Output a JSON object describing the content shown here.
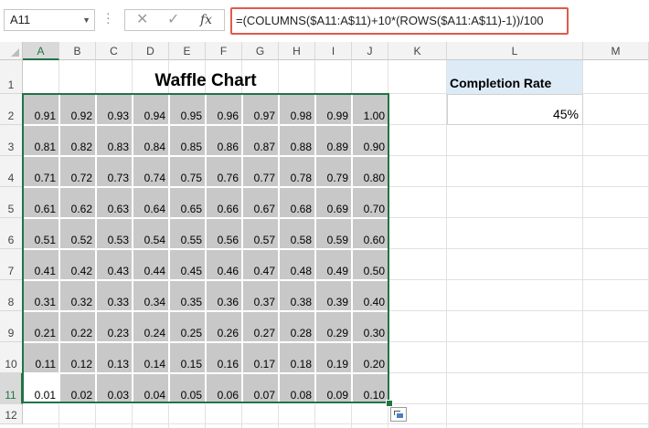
{
  "formula_bar": {
    "name_box": "A11",
    "cancel_glyph": "✕",
    "enter_glyph": "✓",
    "fx_label": "fx",
    "formula": "=(COLUMNS($A11:A$11)+10*(ROWS($A11:A$11)-1))/100"
  },
  "columns": [
    "A",
    "B",
    "C",
    "D",
    "E",
    "F",
    "G",
    "H",
    "I",
    "J",
    "K",
    "L",
    "M"
  ],
  "rows": [
    "1",
    "2",
    "3",
    "4",
    "5",
    "6",
    "7",
    "8",
    "9",
    "10",
    "11",
    "12"
  ],
  "title": "Waffle Chart",
  "waffle": [
    [
      "0.91",
      "0.92",
      "0.93",
      "0.94",
      "0.95",
      "0.96",
      "0.97",
      "0.98",
      "0.99",
      "1.00"
    ],
    [
      "0.81",
      "0.82",
      "0.83",
      "0.84",
      "0.85",
      "0.86",
      "0.87",
      "0.88",
      "0.89",
      "0.90"
    ],
    [
      "0.71",
      "0.72",
      "0.73",
      "0.74",
      "0.75",
      "0.76",
      "0.77",
      "0.78",
      "0.79",
      "0.80"
    ],
    [
      "0.61",
      "0.62",
      "0.63",
      "0.64",
      "0.65",
      "0.66",
      "0.67",
      "0.68",
      "0.69",
      "0.70"
    ],
    [
      "0.51",
      "0.52",
      "0.53",
      "0.54",
      "0.55",
      "0.56",
      "0.57",
      "0.58",
      "0.59",
      "0.60"
    ],
    [
      "0.41",
      "0.42",
      "0.43",
      "0.44",
      "0.45",
      "0.46",
      "0.47",
      "0.48",
      "0.49",
      "0.50"
    ],
    [
      "0.31",
      "0.32",
      "0.33",
      "0.34",
      "0.35",
      "0.36",
      "0.37",
      "0.38",
      "0.39",
      "0.40"
    ],
    [
      "0.21",
      "0.22",
      "0.23",
      "0.24",
      "0.25",
      "0.26",
      "0.27",
      "0.28",
      "0.29",
      "0.30"
    ],
    [
      "0.11",
      "0.12",
      "0.13",
      "0.14",
      "0.15",
      "0.16",
      "0.17",
      "0.18",
      "0.19",
      "0.20"
    ],
    [
      "0.01",
      "0.02",
      "0.03",
      "0.04",
      "0.05",
      "0.06",
      "0.07",
      "0.08",
      "0.09",
      "0.10"
    ]
  ],
  "completion": {
    "label": "Completion Rate",
    "value": "45%"
  },
  "active_cell": "A11",
  "colors": {
    "waffle_fill": "#c8c8c8",
    "active_fill": "#ffffff",
    "header_fill": "#ddebf7",
    "selection": "#217346",
    "formula_highlight": "#e05a4a"
  }
}
